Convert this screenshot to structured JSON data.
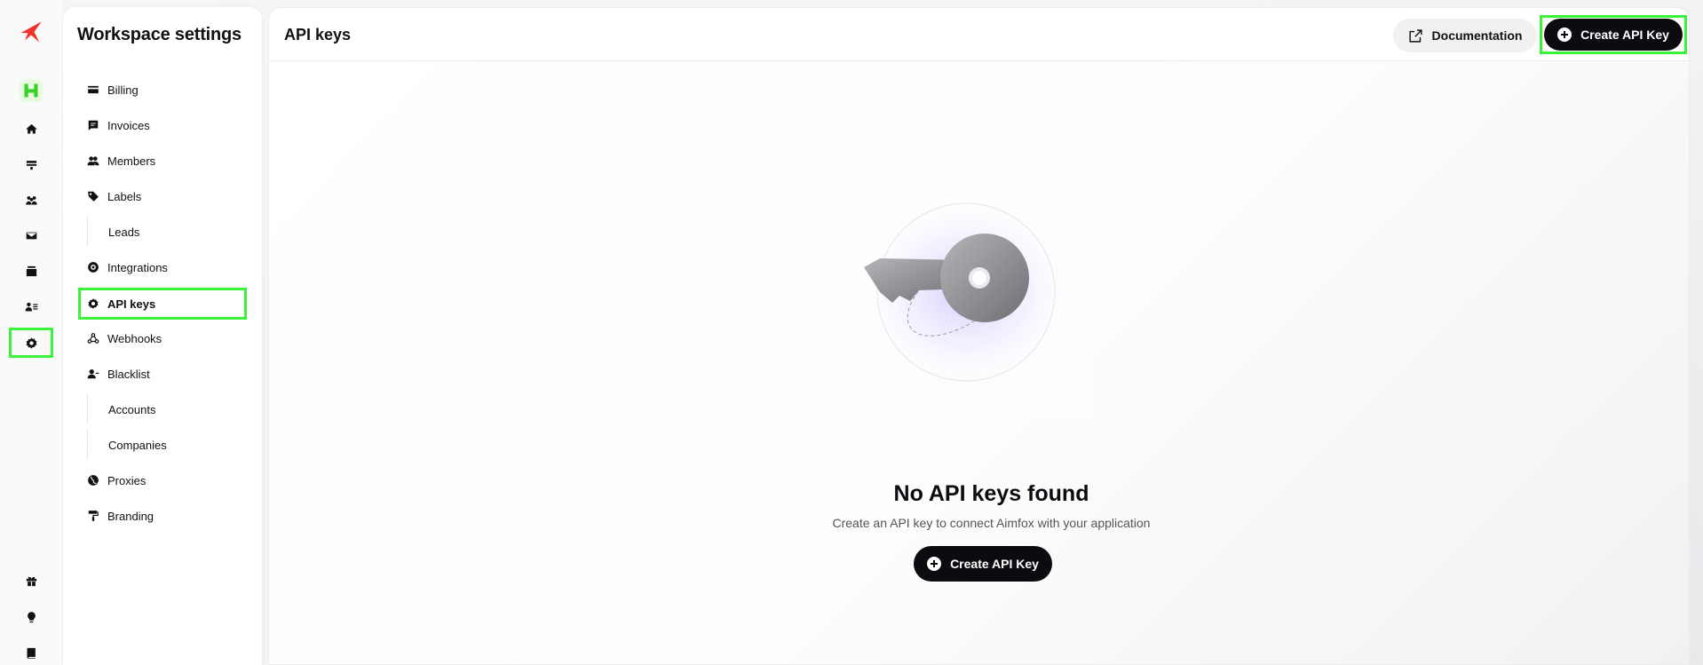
{
  "sidebar": {
    "title": "Workspace settings",
    "items": [
      {
        "label": "Billing"
      },
      {
        "label": "Invoices"
      },
      {
        "label": "Members"
      },
      {
        "label": "Labels"
      },
      {
        "label": "Leads"
      },
      {
        "label": "Integrations"
      },
      {
        "label": "API keys"
      },
      {
        "label": "Webhooks"
      },
      {
        "label": "Blacklist"
      },
      {
        "label": "Accounts"
      },
      {
        "label": "Companies"
      },
      {
        "label": "Proxies"
      },
      {
        "label": "Branding"
      }
    ]
  },
  "header": {
    "title": "API keys",
    "documentation_label": "Documentation",
    "create_label": "Create API Key"
  },
  "empty_state": {
    "title": "No API keys found",
    "description": "Create an API key to connect Aimfox with your application",
    "button_label": "Create API Key"
  },
  "colors": {
    "highlight": "#3df23d",
    "brand": "#f0322a",
    "primary_button": "#0b0b10"
  }
}
